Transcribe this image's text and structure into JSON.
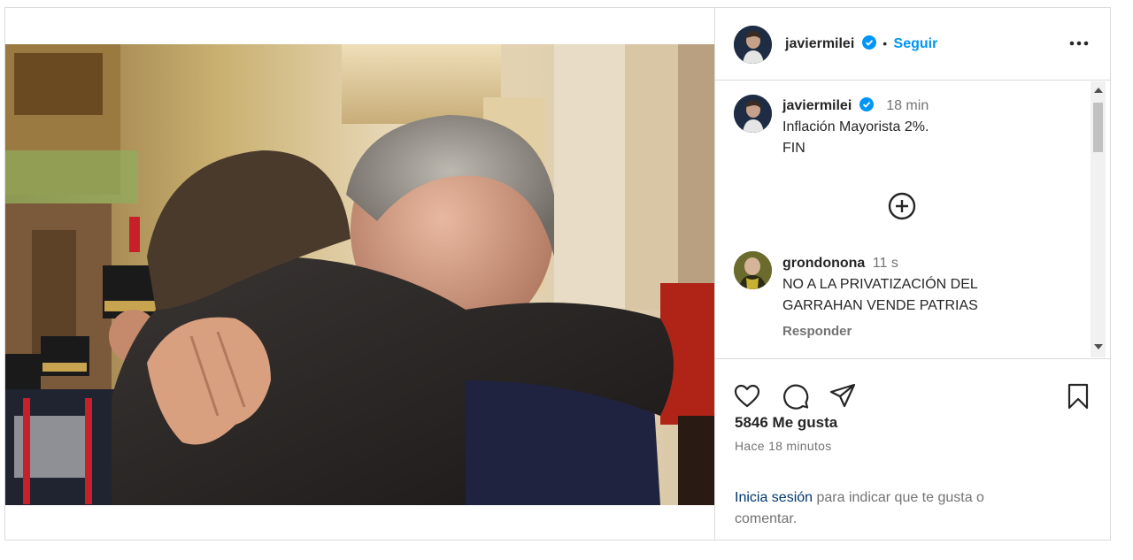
{
  "post": {
    "author": "javiermilei",
    "follow_label": "Seguir",
    "separator": "•",
    "more_icon": "more-horizontal-icon"
  },
  "caption": {
    "author": "javiermilei",
    "time": "18 min",
    "lines": [
      "Inflación Mayorista 2%.",
      "FIN"
    ]
  },
  "load_more_icon": "plus-circle-icon",
  "comment": {
    "author": "grondonona",
    "time": "11 s",
    "lines": [
      "NO A LA PRIVATIZACIÓN DEL",
      "GARRAHAN VENDE PATRIAS"
    ],
    "reply_label": "Responder"
  },
  "actions": {
    "likes": "5846 Me gusta",
    "timestamp": "Hace 18 minutos",
    "login_link": "Inicia sesión",
    "login_rest_1": " para indicar que te gusta o",
    "login_rest_2": "comentar."
  },
  "colors": {
    "accent": "#0095f6",
    "verified": "#0095f6",
    "border": "#dbdbdb",
    "muted": "#737373"
  }
}
